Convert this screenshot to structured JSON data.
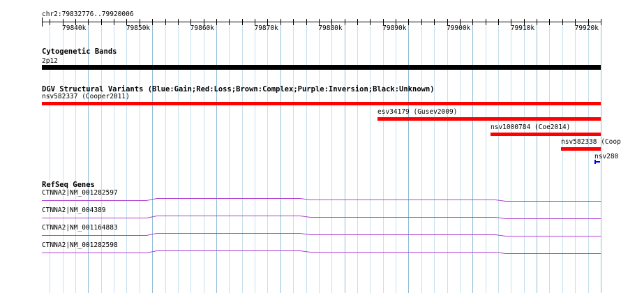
{
  "ruler": {
    "location": "chr2:79832776..79920006",
    "ticks": [
      "79840k",
      "79850k",
      "79860k",
      "79870k",
      "79880k",
      "79890k",
      "79900k",
      "79910k",
      "79920k"
    ],
    "tick_values": [
      79840000,
      79850000,
      79860000,
      79870000,
      79880000,
      79890000,
      79900000,
      79910000,
      79920000
    ],
    "start": 79832776,
    "end": 79920006
  },
  "cytoband": {
    "title": "Cytogenetic Bands",
    "band": "2p12",
    "color": "#000000"
  },
  "dgv": {
    "title": "DGV Structural Variants (Blue:Gain;Red:Loss;Brown:Complex;Purple:Inversion;Black:Unknown)",
    "features": [
      {
        "label": "nsv582337 (Cooper2011)",
        "start": 79832776,
        "end": 79920006,
        "color": "#ff0000"
      },
      {
        "label": "esv34179 (Gusev2009)",
        "start": 79885200,
        "end": 79920006,
        "color": "#ff0000"
      },
      {
        "label": "nsv1000784 (Coe2014)",
        "start": 79902800,
        "end": 79920006,
        "color": "#ff0000"
      },
      {
        "label": "nsv582338 (Coop",
        "start": 79913800,
        "end": 79920006,
        "color": "#ff0000"
      },
      {
        "label": "nsv280",
        "start": 79919000,
        "end": 79920006,
        "color": "#0000ff"
      }
    ]
  },
  "refseq": {
    "title": "RefSeq Genes",
    "color": "#b040d0",
    "genes": [
      {
        "label": "CTNNA2|NM_001282597"
      },
      {
        "label": "CTNNA2|NM_004389"
      },
      {
        "label": "CTNNA2|NM_001164883"
      },
      {
        "label": "CTNNA2|NM_001282598"
      }
    ]
  }
}
